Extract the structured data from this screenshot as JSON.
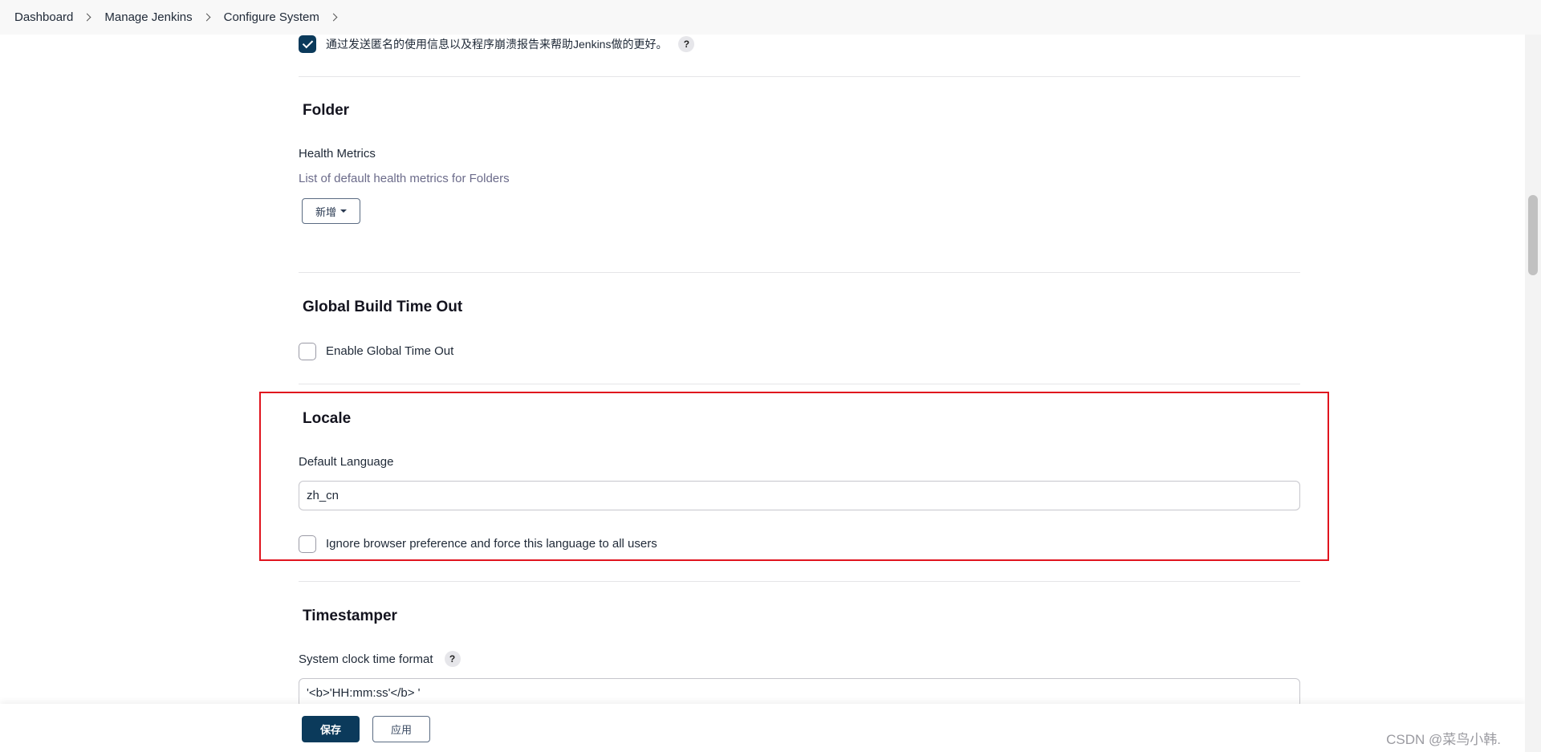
{
  "breadcrumb": {
    "items": [
      "Dashboard",
      "Manage Jenkins",
      "Configure System"
    ]
  },
  "usage_stats": {
    "label": "通过发送匿名的使用信息以及程序崩溃报告来帮助Jenkins做的更好。",
    "checked": true,
    "help": "?"
  },
  "folder": {
    "title": "Folder",
    "health_label": "Health Metrics",
    "health_desc": "List of default health metrics for Folders",
    "add_button": "新增"
  },
  "build_timeout": {
    "title": "Global Build Time Out",
    "enable_label": "Enable Global Time Out",
    "checked": false
  },
  "locale": {
    "title": "Locale",
    "default_language_label": "Default Language",
    "default_language_value": "zh_cn",
    "ignore_label": "Ignore browser preference and force this language to all users",
    "ignore_checked": false
  },
  "timestamper": {
    "title": "Timestamper",
    "clock_format_label": "System clock time format",
    "clock_format_value": "'<b>'HH:mm:ss'</b> '",
    "help": "?"
  },
  "footer": {
    "save_label": "保存",
    "apply_label": "应用",
    "watermark": "CSDN @菜鸟小韩."
  },
  "colors": {
    "primary": "#0b3a5b",
    "highlight": "#e0141e"
  }
}
